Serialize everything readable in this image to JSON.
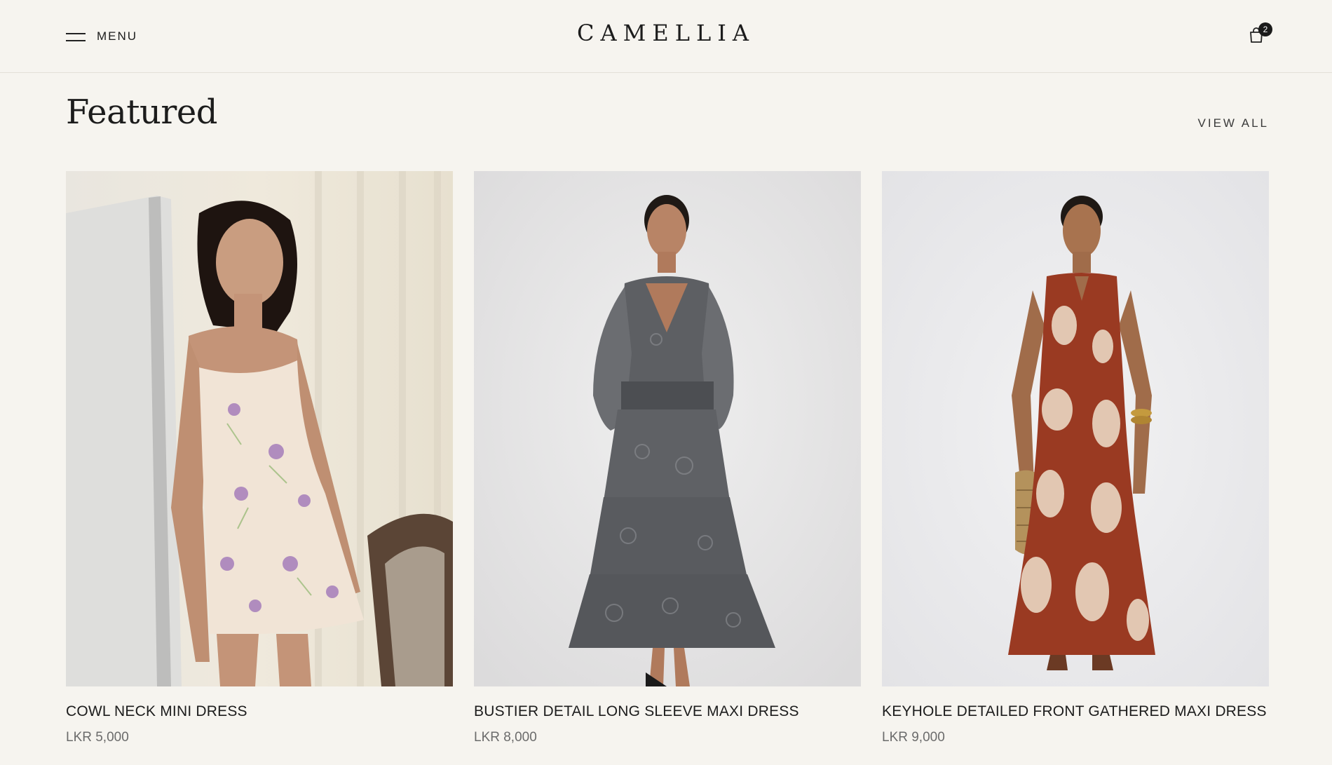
{
  "header": {
    "menu_label": "MENU",
    "logo": "CAMELLIA",
    "cart_count": "2"
  },
  "section": {
    "title": "Featured",
    "view_all": "VIEW ALL"
  },
  "products": [
    {
      "name": "COWL NECK MINI DRESS",
      "price": "LKR 5,000"
    },
    {
      "name": "BUSTIER DETAIL LONG SLEEVE MAXI DRESS",
      "price": "LKR 8,000"
    },
    {
      "name": "KEYHOLE DETAILED FRONT GATHERED MAXI DRESS",
      "price": "LKR 9,000"
    }
  ],
  "colors": {
    "background": "#f6f4ef",
    "text": "#1c1c1c",
    "price": "#6b6b6b",
    "dress_1": "#f1e4d6",
    "dress_2": "#5d5f63",
    "dress_3": "#9a3a22"
  }
}
